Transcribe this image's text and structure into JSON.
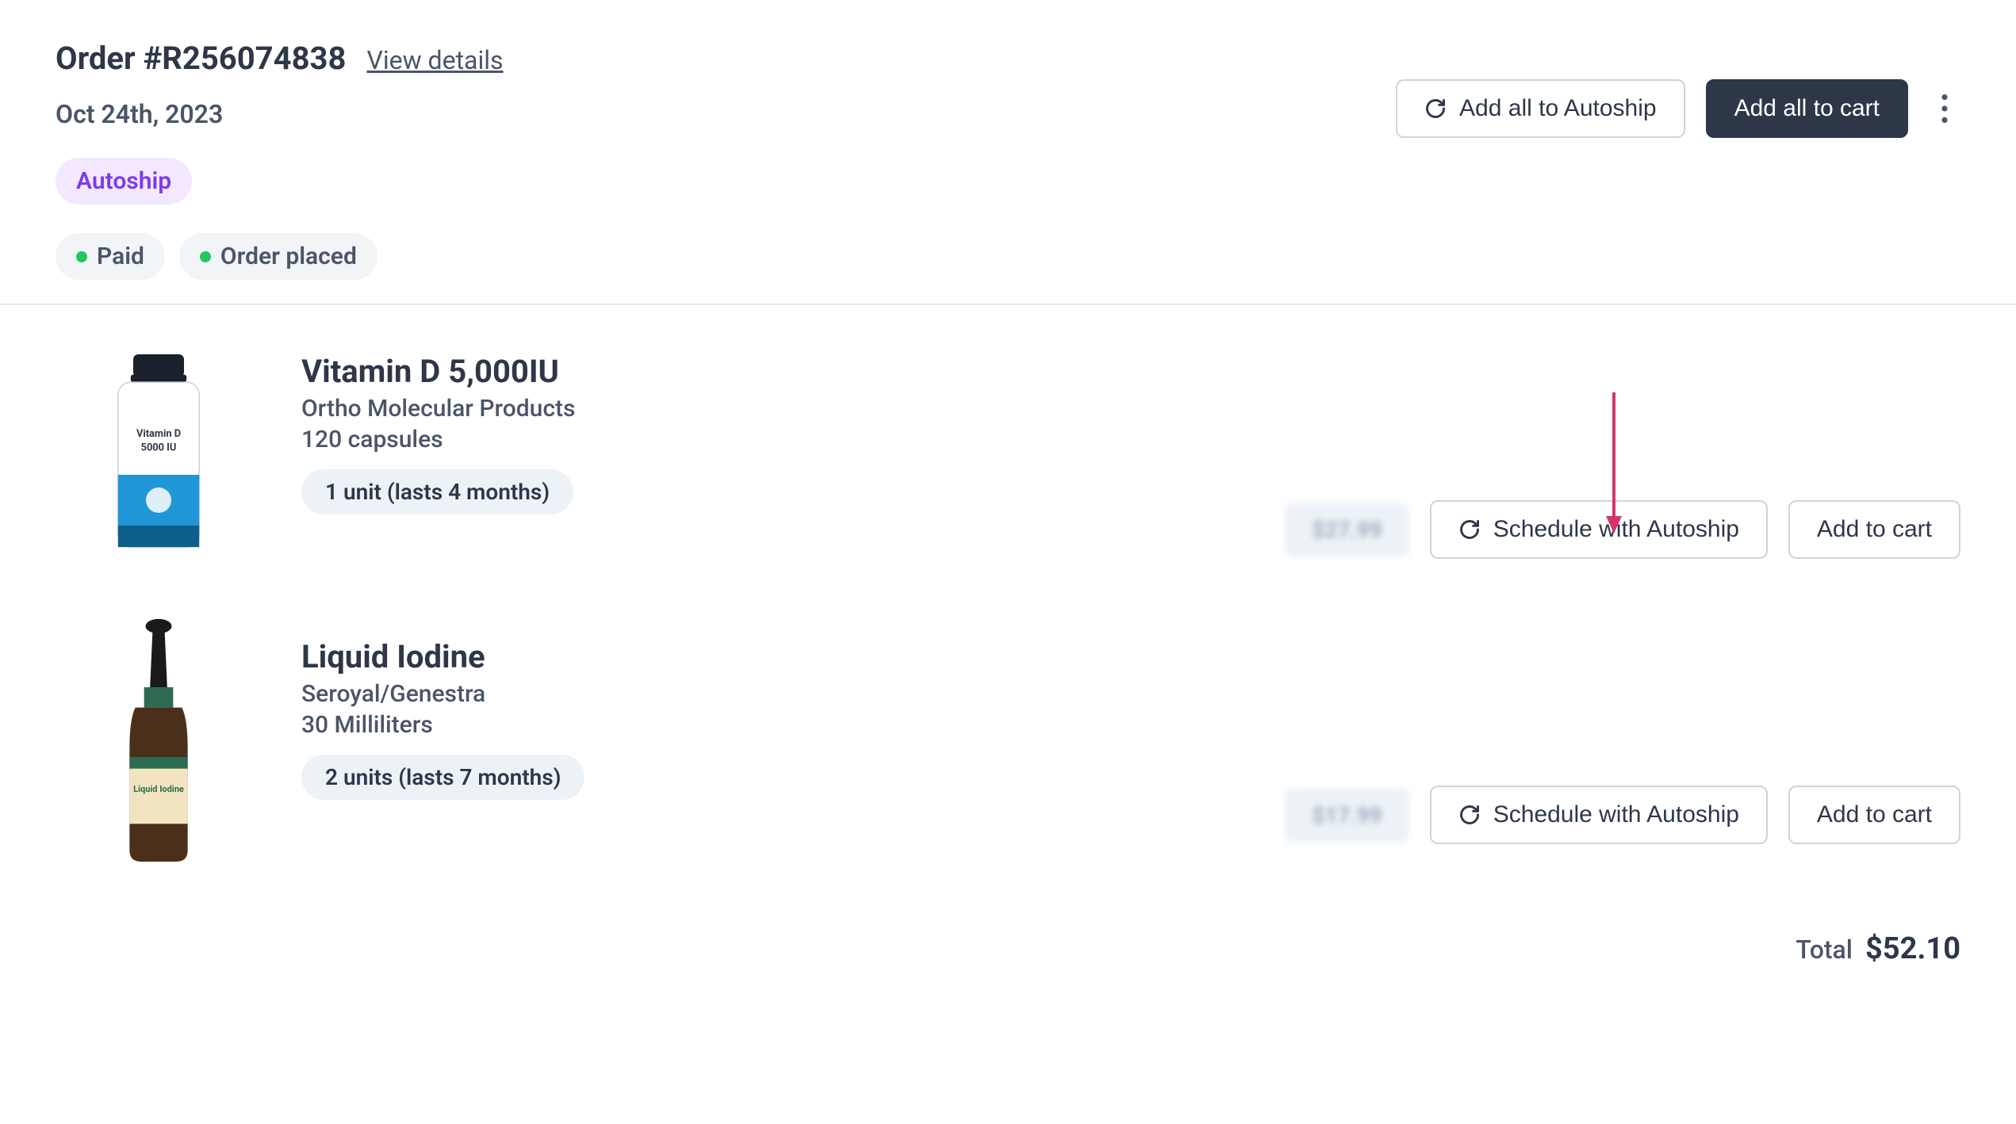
{
  "header": {
    "order_title": "Order #R256074838",
    "view_details": "View details",
    "order_date": "Oct 24th, 2023",
    "autoship_badge": "Autoship",
    "paid_badge": "Paid",
    "order_placed_badge": "Order placed",
    "add_all_autoship": "Add all to Autoship",
    "add_all_cart": "Add all to cart"
  },
  "items": [
    {
      "name": "Vitamin D 5,000IU",
      "brand": "Ortho Molecular Products",
      "size": "120 capsules",
      "unit_info": "1 unit (lasts 4 months)",
      "price": "$27.99",
      "schedule_label": "Schedule with Autoship",
      "add_cart_label": "Add to cart"
    },
    {
      "name": "Liquid Iodine",
      "brand": "Seroyal/Genestra",
      "size": "30 Milliliters",
      "unit_info": "2 units (lasts 7 months)",
      "price": "$17.99",
      "schedule_label": "Schedule with Autoship",
      "add_cart_label": "Add to cart"
    }
  ],
  "total": {
    "label": "Total",
    "value": "$52.10"
  },
  "colors": {
    "accent_purple": "#7c3aed",
    "status_green": "#22c55e",
    "dark": "#2d3748",
    "arrow": "#d6336c"
  }
}
